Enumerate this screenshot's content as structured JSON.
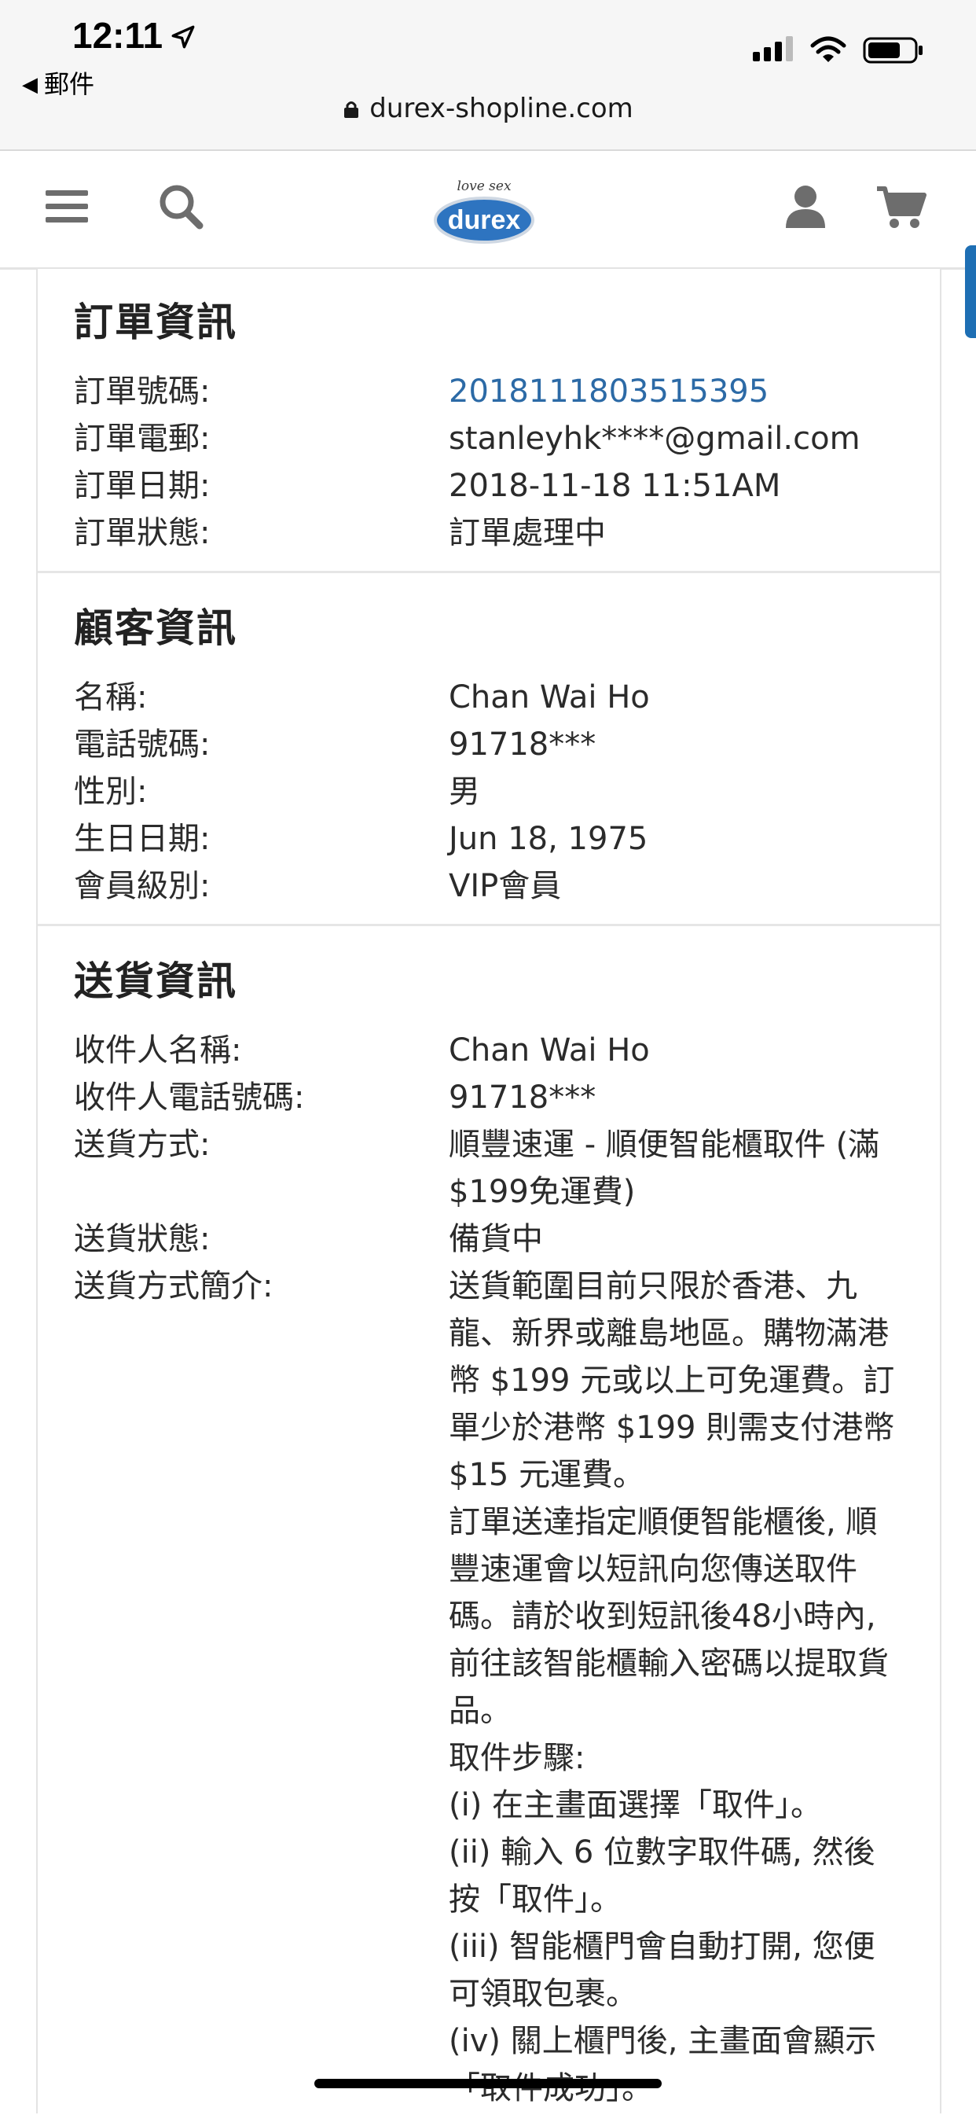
{
  "status_bar": {
    "time": "12:11",
    "back_app": "郵件"
  },
  "browser": {
    "url": "durex-shopline.com"
  },
  "header": {
    "logo_tagline": "love sex",
    "logo_text": "durex"
  },
  "order_info": {
    "title": "訂單資訊",
    "rows": [
      {
        "label": "訂單號碼:",
        "value": "20181118035153​95"
      },
      {
        "label": "訂單電郵:",
        "value": "stanleyhk****@gmail.com"
      },
      {
        "label": "訂單日期:",
        "value": "2018-11-18 11:51AM"
      },
      {
        "label": "訂單狀態:",
        "value": "訂單處理中"
      }
    ]
  },
  "customer_info": {
    "title": "顧客資訊",
    "rows": [
      {
        "label": "名稱:",
        "value": "Chan Wai Ho"
      },
      {
        "label": "電話號碼:",
        "value": "91718***"
      },
      {
        "label": "性別:",
        "value": "男"
      },
      {
        "label": "生日日期:",
        "value": "Jun 18, 1975"
      },
      {
        "label": "會員級別:",
        "value": "VIP會員"
      }
    ]
  },
  "delivery_info": {
    "title": "送貨資訊",
    "rows": [
      {
        "label": "收件人名稱:",
        "value": "Chan Wai Ho"
      },
      {
        "label": "收件人電話號碼:",
        "value": "91718***"
      },
      {
        "label": "送貨方式:",
        "value": "順豐速運 - 順便智能櫃取件 (滿$199免運費)"
      },
      {
        "label": "送貨狀態:",
        "value": "備貨中"
      }
    ],
    "method_desc_label": "送貨方式簡介:",
    "method_desc": [
      "送貨範圍目前只限於香港、九龍、新界或離島地區。購物滿港幣 $199 元或以上可免運費。訂單少於港幣 $199 則需支付港幣 $15 元運費。",
      "訂單送達指定順便智能櫃後, 順豐速運會以短訊向您傳送取件碼。請於收到短訊後48小時內, 前往該智能櫃輸入密碼以提取貨品。",
      "取件步驟:",
      "(i) 在主畫面選擇「取件」。",
      "(ii) 輸入 6 位數字取件碼, 然後按「取件」。",
      "(iii) 智能櫃門會自動打開, 您便可領取包裹。",
      "(iv) 關上櫃門後, 主畫面會顯示「取件成功」。"
    ]
  }
}
